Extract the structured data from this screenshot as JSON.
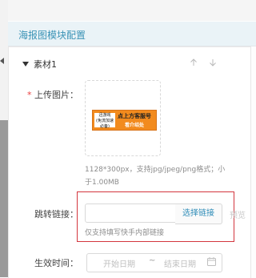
{
  "panel": {
    "title": "海报图模块配置"
  },
  "group": {
    "label": "素材1"
  },
  "upload": {
    "label": "上传图片：",
    "required_mark": "*",
    "banner": {
      "left_line1": "迅游戏",
      "left_line2": "(免流加速必备)",
      "main": "点上方客服号",
      "sub": "看介绍处"
    },
    "hint": "1128*300px，支持jpg/jpeg/png格式；小于1.00MB"
  },
  "link": {
    "label": "跳转链接：",
    "value": "",
    "placeholder": "",
    "select_button": "选择链接",
    "preview": "预览",
    "tip": "仅支持填写快手内部链接"
  },
  "effective_time": {
    "label": "生效时间：",
    "start_placeholder": "开始日期",
    "separator": "~",
    "end_placeholder": "结束日期"
  },
  "colors": {
    "accent": "#2c8bb7",
    "highlight_border": "#d3363e",
    "required": "#e94040"
  }
}
